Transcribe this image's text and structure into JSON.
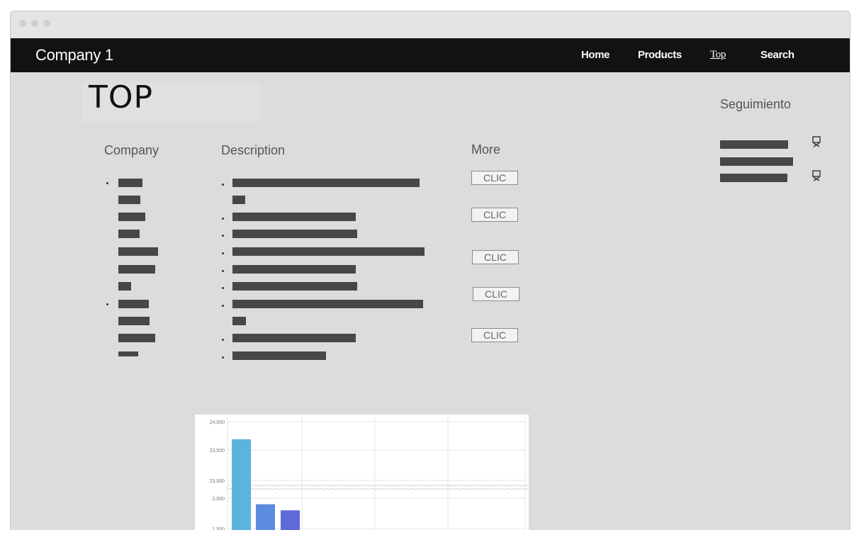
{
  "navbar": {
    "brand": "Company 1",
    "links": [
      "Home",
      "Products",
      "Top",
      "Search"
    ],
    "active_link": "Top"
  },
  "main": {
    "title": "TOP",
    "columns": {
      "company": "Company",
      "description": "Description",
      "more": "More"
    },
    "clic_buttons": [
      "CLIC",
      "CLIC",
      "CLIC",
      "CLIC",
      "CLIC"
    ]
  },
  "sidebar": {
    "title": "Seguimiento"
  },
  "colors": {
    "navbar_bg": "#121212",
    "placeholder_bar": "#474747",
    "window_bg": "#dcdcdc"
  },
  "chart_data": {
    "type": "bar",
    "y_tick_labels": [
      "24,000",
      "23,500",
      "23,000",
      "2,000",
      "1,500"
    ],
    "axis_break": "between 23,000 and 2,000",
    "series_values": [
      23700,
      1900,
      1800
    ],
    "bar_colors": [
      "#5cb3dc",
      "#5d8be0",
      "#5f6ad8"
    ],
    "grid": true
  }
}
